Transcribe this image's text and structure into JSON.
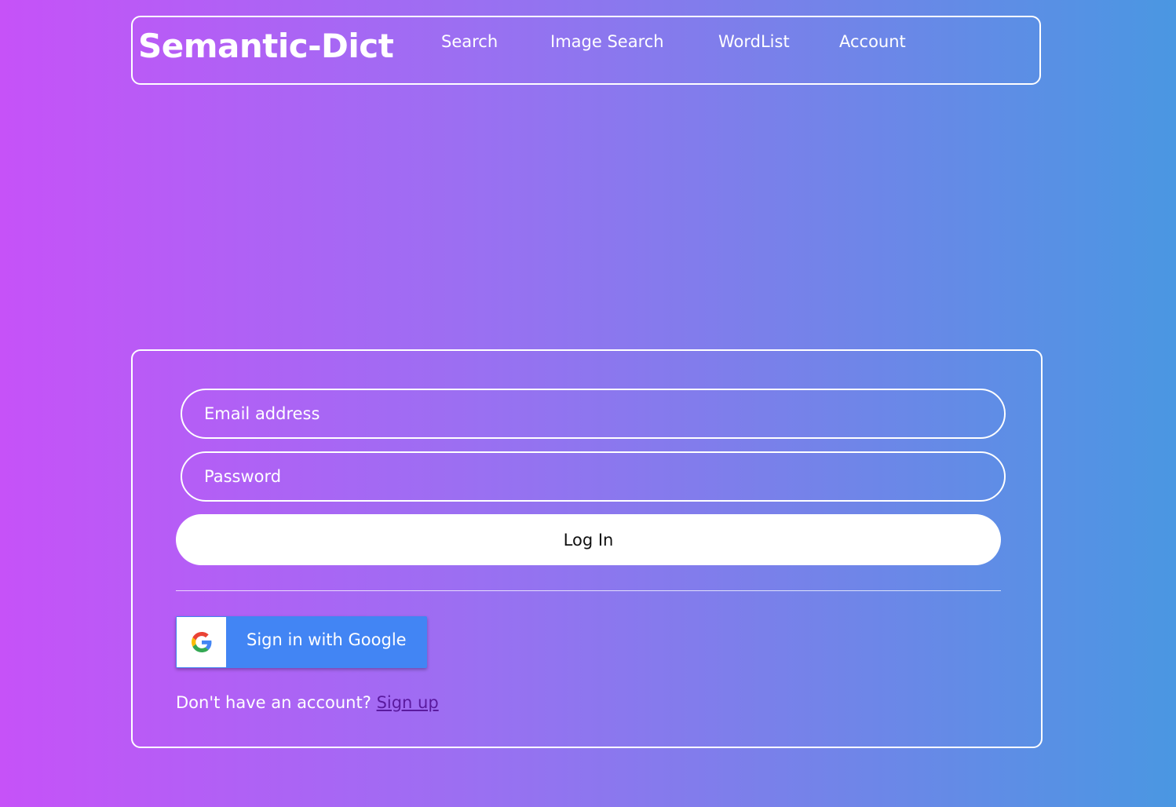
{
  "header": {
    "brand": "Semantic-Dict",
    "nav": {
      "search": "Search",
      "image_search": "Image Search",
      "wordlist": "WordList",
      "account": "Account"
    }
  },
  "login": {
    "email_placeholder": "Email address",
    "password_placeholder": "Password",
    "login_label": "Log In",
    "google_label": "Sign in with Google",
    "signup_prompt": "Don't have an account?",
    "signup_link": "Sign up"
  },
  "colors": {
    "gradient_start": "#c652f8",
    "gradient_end": "#4a97e2",
    "google_blue": "#4285f4",
    "signup_link": "#5a1a9e"
  },
  "icons": {
    "google": "google-g-icon"
  }
}
